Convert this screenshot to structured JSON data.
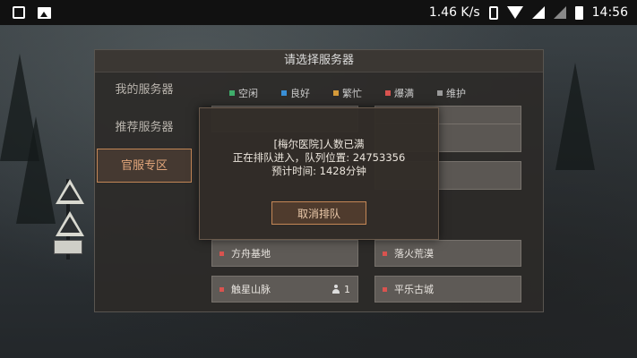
{
  "status_bar": {
    "network_speed": "1.46 K/s",
    "time": "14:56",
    "left_icons": [
      "notification-icon",
      "gallery-icon"
    ],
    "right_icons": [
      "phone-icon",
      "wifi-icon",
      "signal-icon",
      "signal-icon",
      "battery-icon"
    ]
  },
  "panel": {
    "title": "请选择服务器",
    "tabs": [
      {
        "label": "我的服务器",
        "active": false
      },
      {
        "label": "推荐服务器",
        "active": false
      },
      {
        "label": "官服专区",
        "active": true
      }
    ],
    "legend": [
      {
        "label": "空闲",
        "color": "#3fae6b"
      },
      {
        "label": "良好",
        "color": "#3a8fd6"
      },
      {
        "label": "繁忙",
        "color": "#d59a3a"
      },
      {
        "label": "爆满",
        "color": "#d9534f"
      },
      {
        "label": "维护",
        "color": "#9a9a9a"
      }
    ],
    "servers": [
      {
        "name": "方舟基地",
        "status_color": "#d9534f",
        "players": ""
      },
      {
        "name": "落火荒漠",
        "status_color": "#d9534f",
        "players": ""
      },
      {
        "name": "触星山脉",
        "status_color": "#d9534f",
        "players": "1"
      },
      {
        "name": "平乐古城",
        "status_color": "#d9534f",
        "players": ""
      }
    ]
  },
  "dialog": {
    "line1": "[梅尔医院]人数已满",
    "line2_prefix": "正在排队进入，队列位置: ",
    "queue_position": "24753356",
    "line3_prefix": "预计时间: ",
    "wait_time": "1428分钟",
    "cancel_label": "取消排队"
  }
}
